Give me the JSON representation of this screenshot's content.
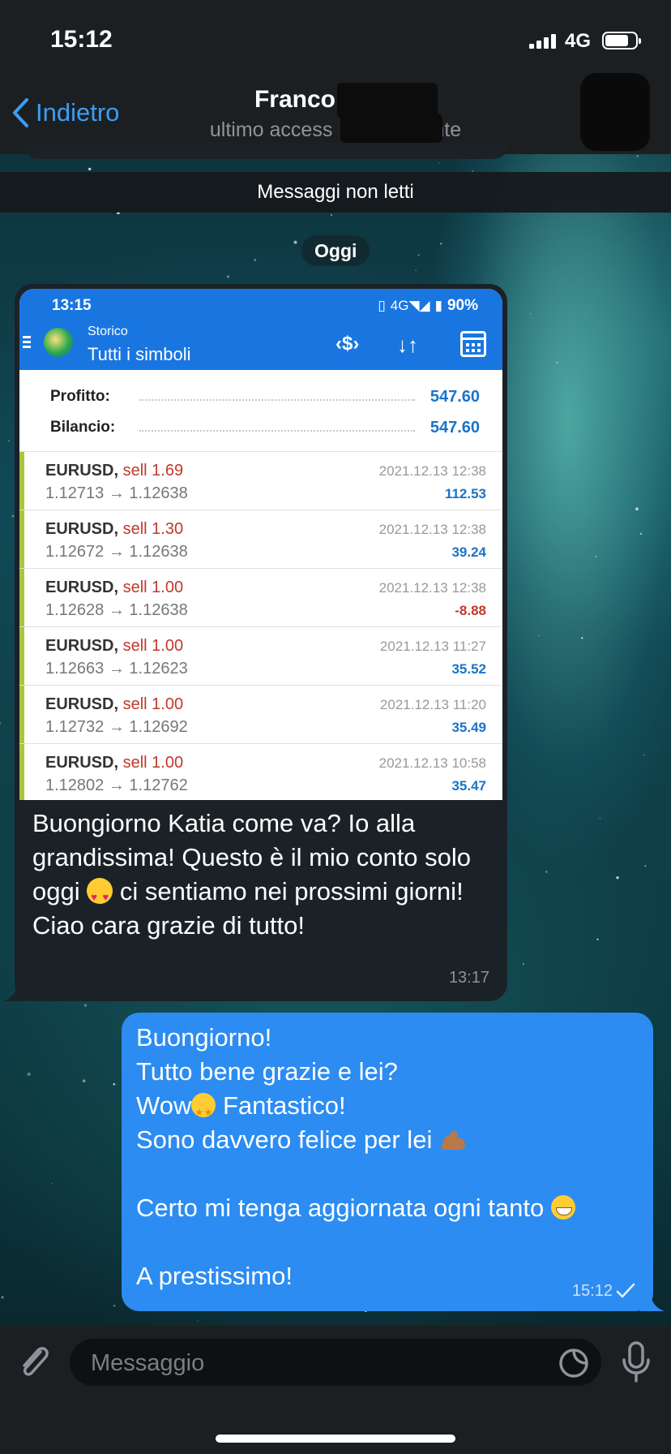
{
  "status_bar": {
    "time": "15:12",
    "network": "4G"
  },
  "header": {
    "back_label": "Indietro",
    "contact_name": "Franco",
    "contact_status_left": "ultimo access",
    "contact_status_right": "nte"
  },
  "unread_label": "Messaggi non letti",
  "date_label": "Oggi",
  "incoming_message": {
    "screenshot": {
      "phone_time": "13:15",
      "battery": "90%",
      "subtitle": "Storico",
      "title": "Tutti i simboli",
      "profit_label": "Profitto:",
      "profit_value": "547.60",
      "balance_label": "Bilancio:",
      "balance_value": "547.60",
      "trades": [
        {
          "symbol": "EURUSD,",
          "side": "sell 1.69",
          "prices": "1.12713 → 1.12638",
          "datetime": "2021.12.13 12:38",
          "pl": "112.53",
          "negative": false
        },
        {
          "symbol": "EURUSD,",
          "side": "sell 1.30",
          "prices": "1.12672 → 1.12638",
          "datetime": "2021.12.13 12:38",
          "pl": "39.24",
          "negative": false
        },
        {
          "symbol": "EURUSD,",
          "side": "sell 1.00",
          "prices": "1.12628 → 1.12638",
          "datetime": "2021.12.13 12:38",
          "pl": "-8.88",
          "negative": true
        },
        {
          "symbol": "EURUSD,",
          "side": "sell 1.00",
          "prices": "1.12663 → 1.12623",
          "datetime": "2021.12.13 11:27",
          "pl": "35.52",
          "negative": false
        },
        {
          "symbol": "EURUSD,",
          "side": "sell 1.00",
          "prices": "1.12732 → 1.12692",
          "datetime": "2021.12.13 11:20",
          "pl": "35.49",
          "negative": false
        },
        {
          "symbol": "EURUSD,",
          "side": "sell 1.00",
          "prices": "1.12802 → 1.12762",
          "datetime": "2021.12.13 10:58",
          "pl": "35.47",
          "negative": false
        }
      ]
    },
    "text_part1": "Buongiorno Katia come va? Io alla grandissima! Questo è il mio conto solo oggi ",
    "text_part2": " ci sentiamo nei prossimi giorni! Ciao cara grazie di tutto!",
    "time": "13:17"
  },
  "outgoing_message": {
    "line1": "Buongiorno!",
    "line2": "Tutto bene grazie e lei?",
    "line3a": "Wow",
    "line3b": " Fantastico!",
    "line4": "Sono davvero felice per lei ",
    "line5": "Certo mi tenga aggiornata ogni tanto ",
    "line6": "A prestissimo!",
    "time": "15:12"
  },
  "input": {
    "placeholder": "Messaggio"
  },
  "colors": {
    "accent": "#3b9ef5",
    "outgoing_bubble": "#2c8cf2",
    "incoming_bubble": "#1b2227",
    "mt_header": "#1976e1"
  }
}
